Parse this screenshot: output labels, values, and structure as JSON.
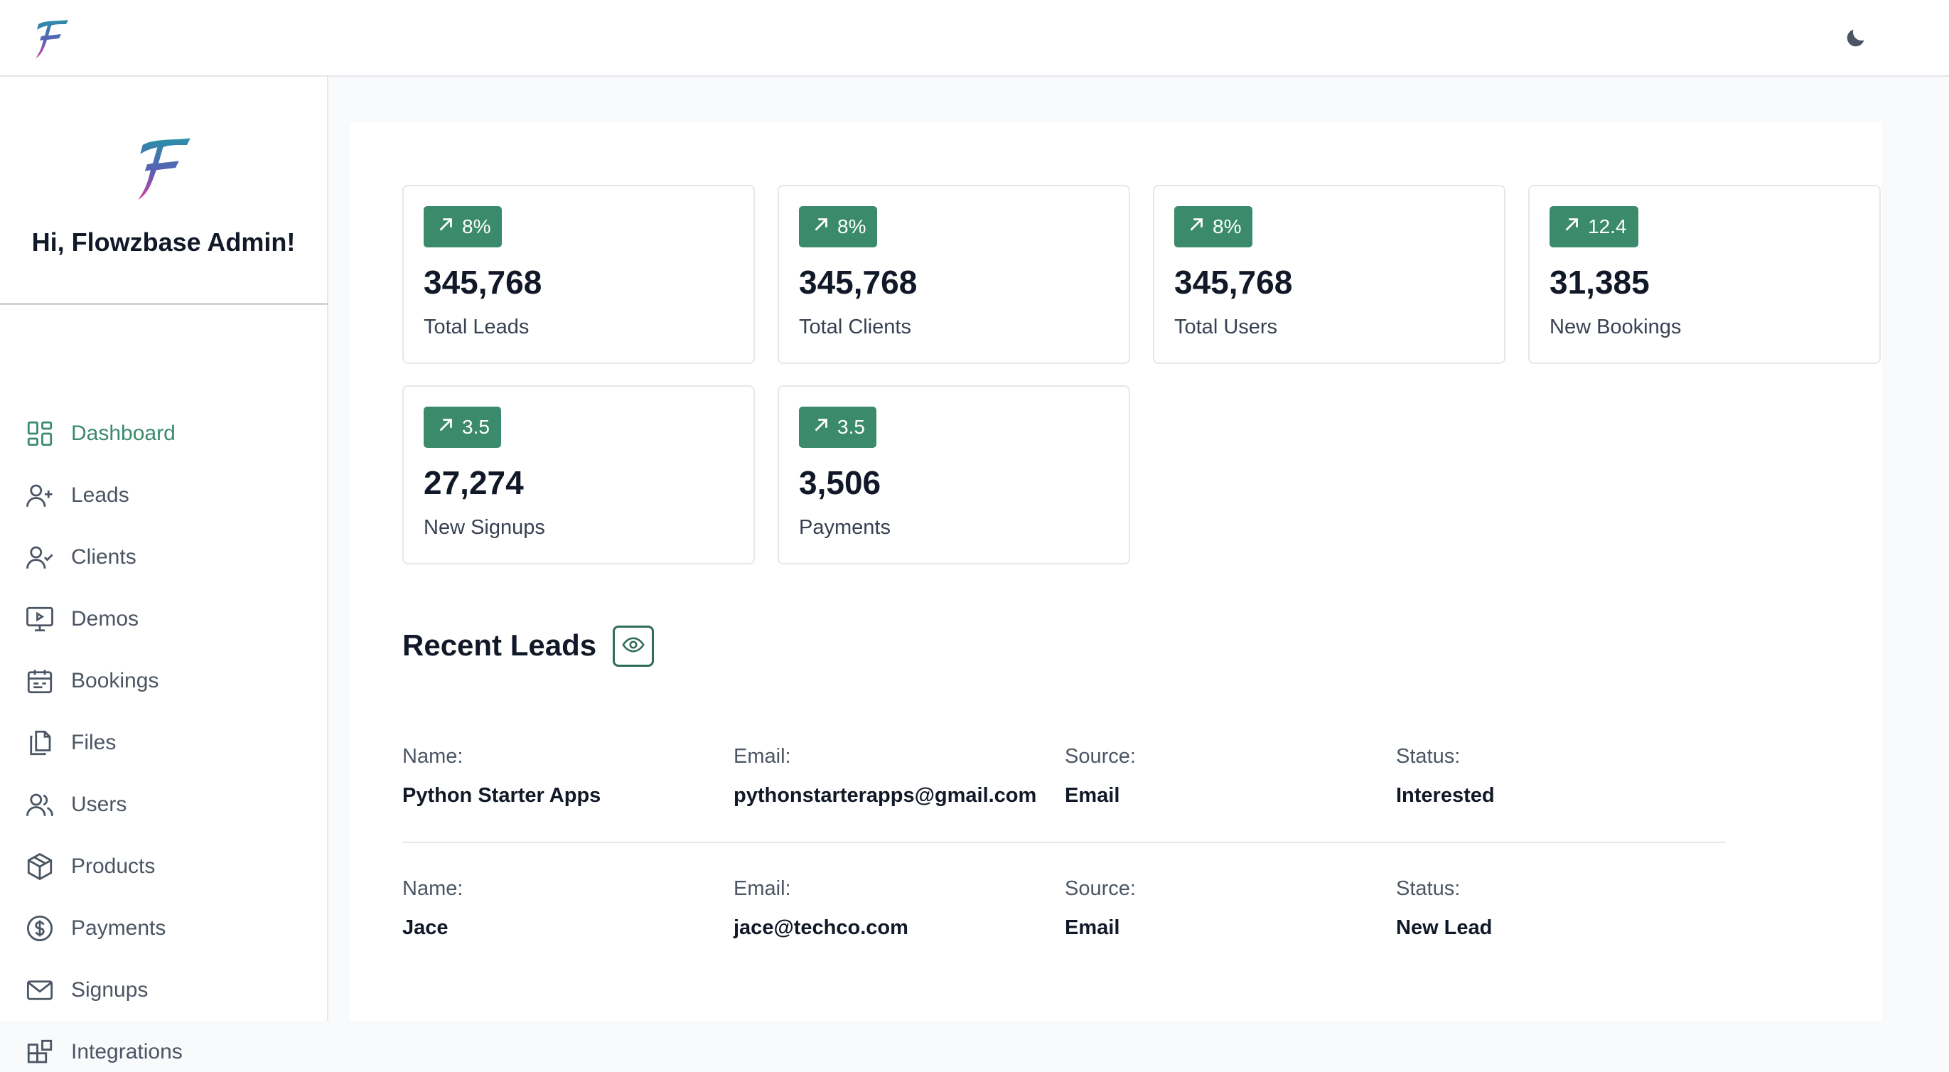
{
  "header": {
    "logo_icon": "flowzbase-f-logo",
    "theme_toggle_icon": "moon-icon"
  },
  "sidebar": {
    "greeting": "Hi, Flowzbase Admin!",
    "items": [
      {
        "label": "Dashboard",
        "icon": "dashboard-icon",
        "active": true
      },
      {
        "label": "Leads",
        "icon": "user-plus-icon"
      },
      {
        "label": "Clients",
        "icon": "user-check-icon"
      },
      {
        "label": "Demos",
        "icon": "presentation-icon"
      },
      {
        "label": "Bookings",
        "icon": "calendar-icon"
      },
      {
        "label": "Files",
        "icon": "files-icon"
      },
      {
        "label": "Users",
        "icon": "users-icon"
      },
      {
        "label": "Products",
        "icon": "package-icon"
      },
      {
        "label": "Payments",
        "icon": "dollar-circle-icon"
      },
      {
        "label": "Signups",
        "icon": "mail-icon"
      },
      {
        "label": "Integrations",
        "icon": "integrations-icon"
      }
    ]
  },
  "stats": [
    {
      "change": "8%",
      "value": "345,768",
      "label": "Total Leads"
    },
    {
      "change": "8%",
      "value": "345,768",
      "label": "Total Clients"
    },
    {
      "change": "8%",
      "value": "345,768",
      "label": "Total Users"
    },
    {
      "change": "12.4",
      "value": "31,385",
      "label": "New Bookings"
    },
    {
      "change": "3.5",
      "value": "27,274",
      "label": "New Signups"
    },
    {
      "change": "3.5",
      "value": "3,506",
      "label": "Payments"
    }
  ],
  "recent_leads": {
    "title": "Recent Leads",
    "view_icon": "eye-icon",
    "field_labels": {
      "name": "Name:",
      "email": "Email:",
      "source": "Source:",
      "status": "Status:"
    },
    "rows": [
      {
        "name": "Python Starter Apps",
        "email": "pythonstarterapps@gmail.com",
        "source": "Email",
        "status": "Interested"
      },
      {
        "name": "Jace",
        "email": "jace@techco.com",
        "source": "Email",
        "status": "New Lead"
      }
    ]
  },
  "colors": {
    "accent": "#3a8a6b",
    "text": "#111827",
    "muted": "#4b5563",
    "border": "#e5e7eb"
  }
}
